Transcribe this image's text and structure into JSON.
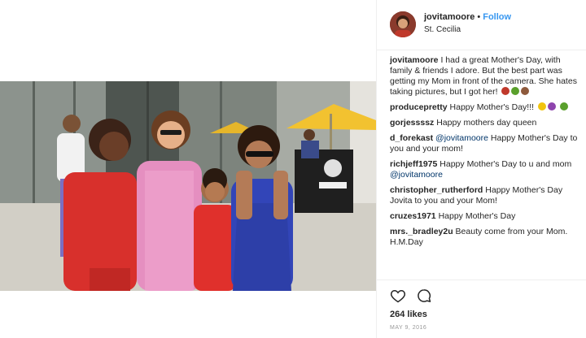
{
  "post": {
    "username": "jovitamoore",
    "dot": "•",
    "follow_label": "Follow",
    "location": "St. Cecilia"
  },
  "comments": [
    {
      "user": "jovitamoore",
      "text": "I had a great Mother's Day, with family & friends I adore. But the best part was getting my Mom in front of the camera. She hates taking pictures, but I got her!",
      "emojis": [
        "#c0392b",
        "#5aa02c",
        "#8e5a3c"
      ]
    },
    {
      "user": "producepretty",
      "text": "Happy Mother's Day!!!",
      "emojis": [
        "#f1c40f",
        "#8e44ad",
        "#5aa02c"
      ]
    },
    {
      "user": "gorjessssz",
      "text": "Happy mothers day queen"
    },
    {
      "user": "d_forekast",
      "mention": "@jovitamoore",
      "text": "Happy Mother's Day to you and your mom!"
    },
    {
      "user": "richjeff1975",
      "text": "Happy Mother's Day to u and mom",
      "mention_after": "@jovitamoore"
    },
    {
      "user": "christopher_rutherford",
      "text": "Happy Mother's Day Jovita to you and your Mom!"
    },
    {
      "user": "cruzes1971",
      "text": "Happy Mother's Day"
    },
    {
      "user": "mrs._bradley2u",
      "text": "Beauty come from your Mom. H.M.Day"
    }
  ],
  "likes": "264 likes",
  "date": "MAY 9, 2016",
  "icons": {
    "like": "heart-icon",
    "comment": "comment-icon"
  },
  "colors": {
    "follow": "#3897f0",
    "mention": "#003569",
    "umbrella": "#f2c230"
  }
}
